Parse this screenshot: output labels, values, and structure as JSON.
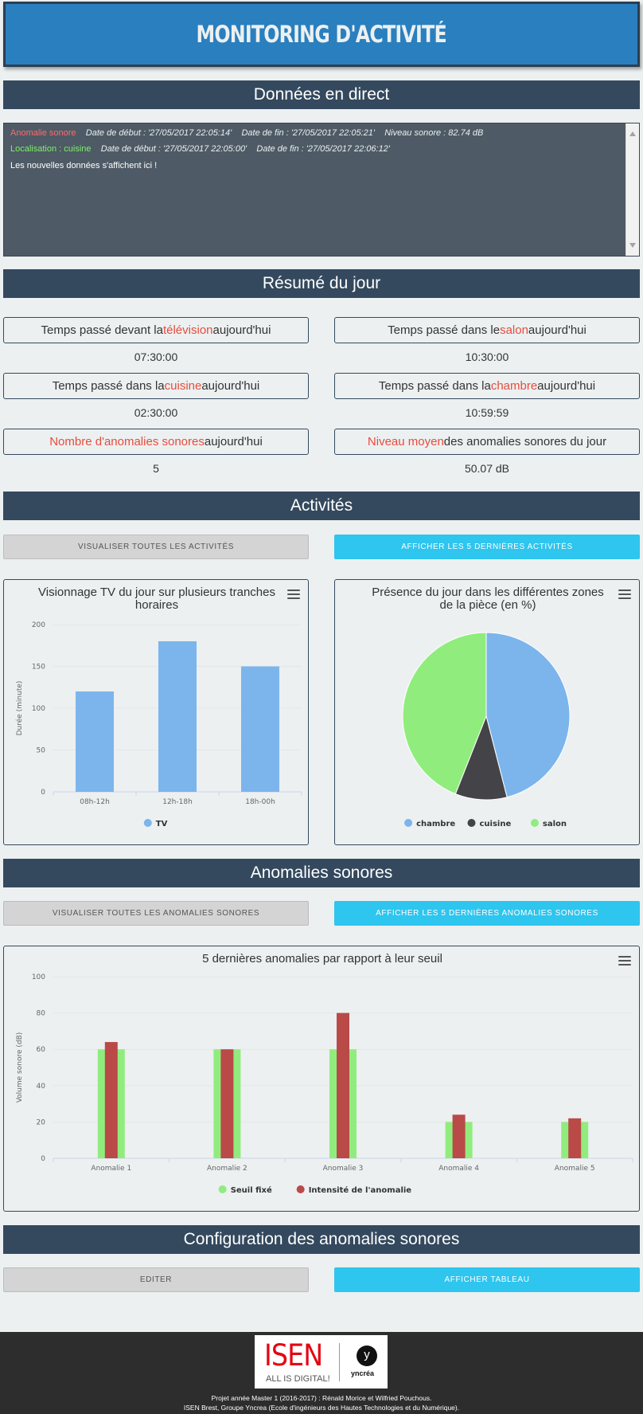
{
  "header": {
    "title": "MONITORING D'ACTIVITÉ"
  },
  "sections": {
    "live": "Données en direct",
    "summary": "Résumé du jour",
    "activities": "Activités",
    "anomalies": "Anomalies sonores",
    "config": "Configuration des anomalies sonores"
  },
  "live": {
    "line1": {
      "label": "Anomalie sonore",
      "start": "Date de début : '27/05/2017 22:05:14'",
      "end": "Date de fin : '27/05/2017 22:05:21'",
      "level": "Niveau sonore : 82.74 dB"
    },
    "line2": {
      "label": "Localisation : cuisine",
      "start": "Date de début : '27/05/2017 22:05:00'",
      "end": "Date de fin : '27/05/2017 22:06:12'"
    },
    "line3": "Les nouvelles données s'affichent ici !"
  },
  "summary": {
    "tv": {
      "pre": "Temps passé devant la ",
      "hl": "télévision",
      "post": " aujourd'hui",
      "value": "07:30:00"
    },
    "salon": {
      "pre": "Temps passé dans le ",
      "hl": "salon",
      "post": " aujourd'hui",
      "value": "10:30:00"
    },
    "cuisine": {
      "pre": "Temps passé dans la ",
      "hl": "cuisine",
      "post": " aujourd'hui",
      "value": "02:30:00"
    },
    "chambre": {
      "pre": "Temps passé dans la ",
      "hl": "chambre",
      "post": " aujourd'hui",
      "value": "10:59:59"
    },
    "count": {
      "pre": "",
      "hl": "Nombre d'anomalies sonores",
      "post": " aujourd'hui",
      "value": "5"
    },
    "level": {
      "pre": "",
      "hl": "Niveau moyen",
      "post": " des anomalies sonores du jour",
      "value": "50.07 dB"
    }
  },
  "buttons": {
    "all_activities": "Visualiser toutes les activités",
    "last_activities": "Afficher les 5 dernières activités",
    "all_anomalies": "Visualiser toutes les anomalies sonores",
    "last_anomalies": "Afficher les 5 dernières anomalies sonores",
    "edit": "Editer",
    "show_table": "Afficher tableau"
  },
  "colors": {
    "blue": "#7cb5ec",
    "dark": "#434348",
    "green": "#90ed7d",
    "red": "#b94a48"
  },
  "chart_data": [
    {
      "type": "bar",
      "title": "Visionnage TV du jour sur plusieurs tranches horaires",
      "title_lines": [
        "Visionnage TV du jour sur plusieurs tranches",
        "horaires"
      ],
      "categories": [
        "08h-12h",
        "12h-18h",
        "18h-00h"
      ],
      "series": [
        {
          "name": "TV",
          "values": [
            120,
            180,
            150
          ]
        }
      ],
      "ylabel": "Durée (minute)",
      "ylim": [
        0,
        200
      ],
      "yticks": [
        0,
        50,
        100,
        150,
        200
      ],
      "grid": true,
      "legend": "bottom"
    },
    {
      "type": "pie",
      "title": "Présence du jour dans les différentes zones de la pièce (en %)",
      "title_lines": [
        "Présence du jour dans les différentes zones",
        "de la pièce (en %)"
      ],
      "categories": [
        "chambre",
        "cuisine",
        "salon"
      ],
      "values": [
        46,
        10,
        44
      ],
      "legend": "bottom"
    },
    {
      "type": "bar",
      "title": "5 dernières anomalies par rapport à leur seuil",
      "categories": [
        "Anomalie 1",
        "Anomalie 2",
        "Anomalie 3",
        "Anomalie 4",
        "Anomalie 5"
      ],
      "series": [
        {
          "name": "Seuil fixé",
          "values": [
            60,
            60,
            60,
            20,
            20
          ]
        },
        {
          "name": "Intensité de l'anomalie",
          "values": [
            64,
            60,
            80,
            24,
            22
          ]
        }
      ],
      "ylabel": "Volume sonore (dB)",
      "ylim": [
        0,
        100
      ],
      "yticks": [
        0,
        20,
        40,
        60,
        80,
        100
      ],
      "grid": true,
      "legend": "bottom"
    }
  ],
  "footer": {
    "logo_main": "ISEN",
    "logo_tagline": "ALL IS DIGITAL!",
    "logo_partner": "yncréa",
    "line1": "Projet année Master 1 (2016-2017) : Rénald Morice et Wilfried Pouchous.",
    "line2": "ISEN Brest, Groupe Yncrea (Ecole d'ingénieurs des Hautes Technologies et du Numérique)."
  }
}
